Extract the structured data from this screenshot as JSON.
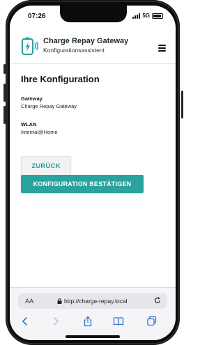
{
  "status_bar": {
    "time": "07:26",
    "network": "5G"
  },
  "app": {
    "title": "Charge Repay Gateway",
    "subtitle": "Konfigurationsassistent",
    "brand_color": "#2aa39e"
  },
  "main": {
    "heading": "Ihre Konfiguration",
    "fields": [
      {
        "label": "Gateway",
        "value": "Charge Repay Gateway"
      },
      {
        "label": "WLAN",
        "value": "Internal@Home"
      }
    ],
    "back_label": "ZURÜCK",
    "confirm_label": "KONFIGURATION BESTÄTIGEN"
  },
  "browser": {
    "aa_label": "AA",
    "url": "http://charge-repay.local"
  },
  "icons": [
    "menu-icon",
    "logo-icon",
    "lock-icon",
    "reload-icon",
    "back-arrow-icon",
    "forward-arrow-icon",
    "share-icon",
    "bookmarks-icon",
    "tabs-icon"
  ]
}
